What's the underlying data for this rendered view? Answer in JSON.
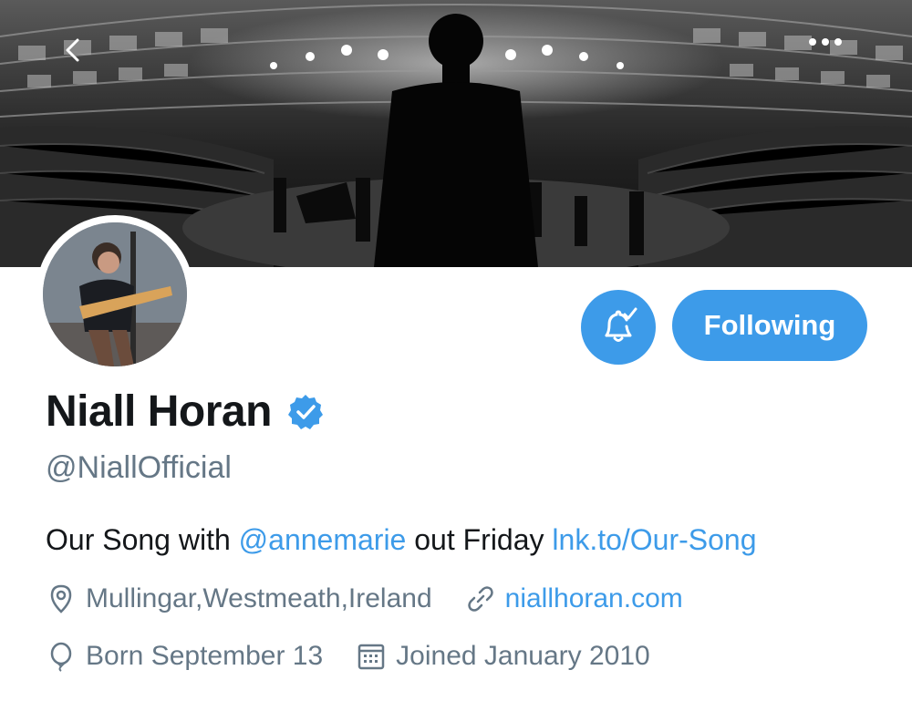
{
  "header": {
    "back_icon": "chevron-left-icon",
    "more_icon": "more-horizontal-icon"
  },
  "profile": {
    "display_name": "Niall Horan",
    "verified": true,
    "handle": "@NiallOfficial",
    "bio": {
      "prefix": "Our Song with ",
      "mention": "@annemarie",
      "middle": " out Friday ",
      "link": "lnk.to/Our-Song"
    },
    "location": "Mullingar,Westmeath,Ireland",
    "website": "niallhoran.com",
    "birthday": "Born September 13",
    "joined": "Joined January 2010"
  },
  "actions": {
    "notifications_icon": "bell-check-icon",
    "follow_label": "Following"
  },
  "colors": {
    "accent": "#3d9be9",
    "text_primary": "#14171a",
    "text_secondary": "#657786"
  }
}
